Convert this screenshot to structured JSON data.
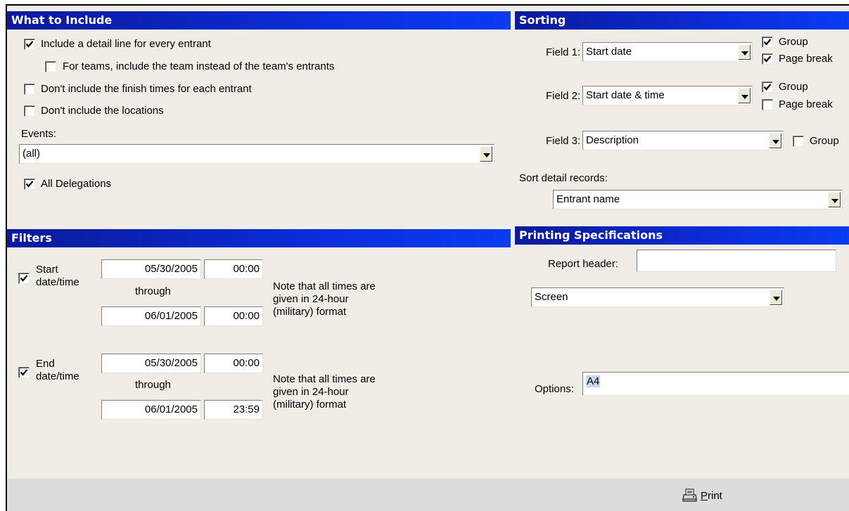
{
  "include": {
    "header": "What to Include",
    "detail_line": {
      "label": "Include a detail line for every entrant",
      "checked": true
    },
    "teams": {
      "label": "For teams, include the team instead of the team's entrants",
      "checked": false
    },
    "no_finish_times": {
      "label": "Don't include the finish times for each entrant",
      "checked": false
    },
    "no_locations": {
      "label": "Don't include the locations",
      "checked": false
    },
    "events_label": "Events:",
    "events_value": "(all)",
    "all_delegations": {
      "label": "All Delegations",
      "checked": true
    }
  },
  "sorting": {
    "header": "Sorting",
    "field1": {
      "label": "Field 1:",
      "value": "Start date",
      "group_label": "Group",
      "group": true,
      "pagebreak_label": "Page break",
      "pagebreak": true
    },
    "field2": {
      "label": "Field 2:",
      "value": "Start date & time",
      "group_label": "Group",
      "group": true,
      "pagebreak_label": "Page break",
      "pagebreak": false
    },
    "field3": {
      "label": "Field 3:",
      "value": "Description",
      "group_label": "Group",
      "group": false
    },
    "detail_label": "Sort detail records:",
    "detail_value": "Entrant name"
  },
  "filters": {
    "header": "Filters",
    "start": {
      "label1": "Start",
      "label2": "date/time",
      "checked": true,
      "from_date": "05/30/2005",
      "from_time": "00:00",
      "through": "through",
      "to_date": "06/01/2005",
      "to_time": "00:00",
      "note1": "Note that all times are",
      "note2": "given in 24-hour",
      "note3": "(military) format"
    },
    "end": {
      "label1": "End",
      "label2": "date/time",
      "checked": true,
      "from_date": "05/30/2005",
      "from_time": "00:00",
      "through": "through",
      "to_date": "06/01/2005",
      "to_time": "23:59",
      "note1": "Note that all times are",
      "note2": "given in 24-hour",
      "note3": "(military) format"
    }
  },
  "printing": {
    "header": "Printing Specifications",
    "report_header_label": "Report header:",
    "report_header_value": "",
    "output": "Screen",
    "options_label": "Options:",
    "options_value": "A4"
  },
  "footer": {
    "print_label": "Print",
    "print_icon": "printer-icon"
  }
}
